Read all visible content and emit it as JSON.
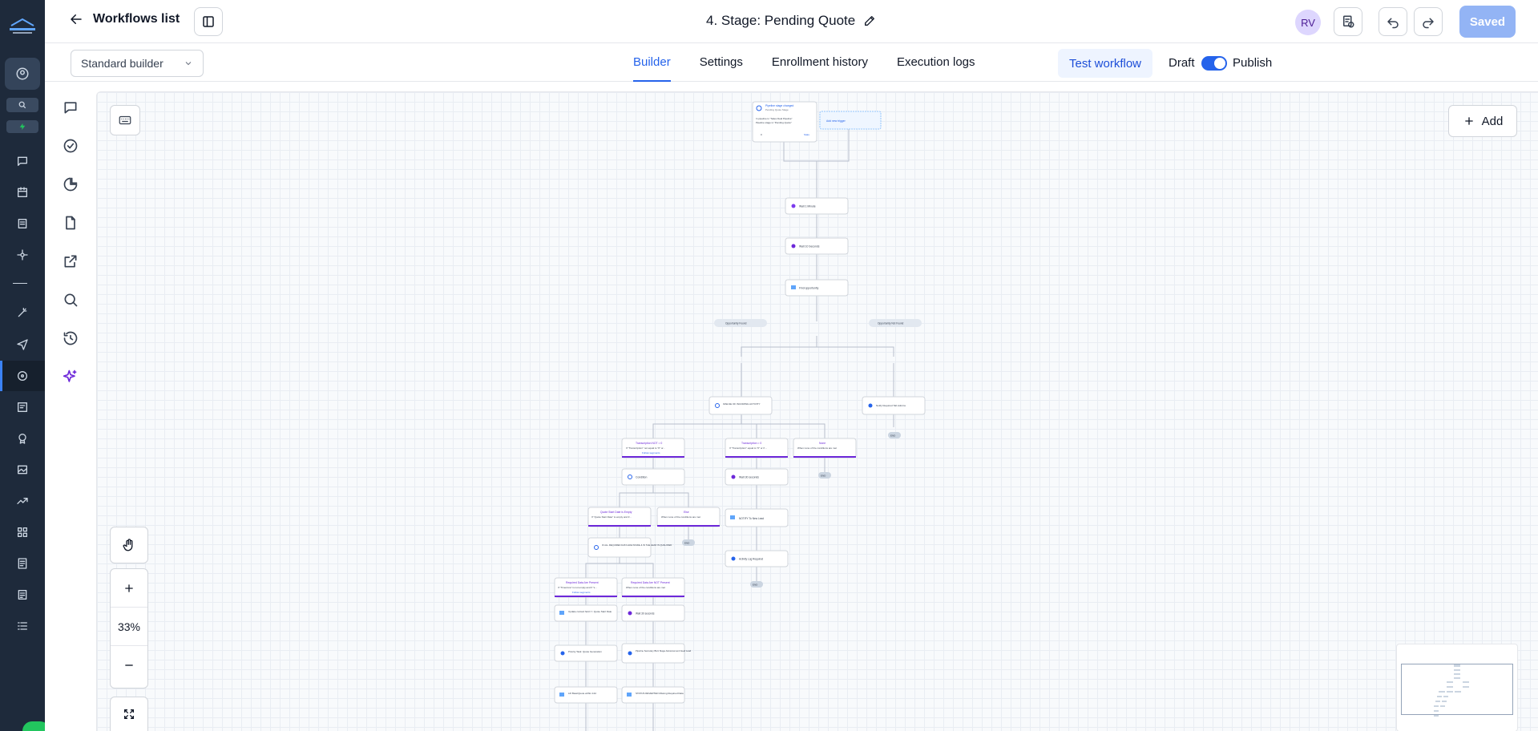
{
  "header": {
    "back_label": "Workflows list",
    "workflow_title": "4. Stage: Pending Quote",
    "avatar_initials": "RV",
    "saved_label": "Saved"
  },
  "subheader": {
    "builder_mode": "Standard builder",
    "tabs": [
      {
        "label": "Builder",
        "active": true
      },
      {
        "label": "Settings",
        "active": false
      },
      {
        "label": "Enrollment history",
        "active": false
      },
      {
        "label": "Execution logs",
        "active": false
      }
    ],
    "test_label": "Test workflow",
    "draft_label": "Draft",
    "publish_label": "Publish",
    "publish_on": true
  },
  "canvas": {
    "add_label": "Add",
    "zoom_level": "33%"
  },
  "colors": {
    "accent": "#2563eb",
    "rail": "#1e2a3b",
    "node_accent": "#6d28d9"
  },
  "flow": {
    "trigger": {
      "title": "Pipeline stage changed",
      "subtitle": "Pending Quote Stage",
      "line1": "In pipeline is \"Sales Deal Pipeline\"",
      "line2": "Pipeline stage is \"Pending Quote\"",
      "count": "0",
      "stats": "Stats"
    },
    "add_trigger": "Add new trigger",
    "steps": {
      "wait1": "Wait 1 Minute",
      "wait2": "Wait 10 Seconds",
      "find": "Find opportunity",
      "found": "Opportunity Found",
      "not_found": "Opportunity Not Found",
      "notify": "Notify Required Tab Admins",
      "end1": "END",
      "ifelse1": "IF/ELSE OF INCOMING ACTIVITY",
      "branch_a": "Transcription NOT = 0",
      "branch_a_desc": "If \"Transcription\" not equal to \"0\" or...",
      "branch_b": "Transcription = 0",
      "branch_b_desc": "If \"Transcription\" equal to \"0\" or if ...",
      "branch_c": "None",
      "branch_c_desc": "When none of the conditions are met",
      "follow": "Follow segments",
      "end2": "END",
      "condition": "Condition",
      "wait3": "Wait 30 seconds",
      "qsd_empty": "Quote Start Date is Empty",
      "qsd_empty_desc": "If \"Quote Start Date\" is empty and if...",
      "else": "Else",
      "else_desc": "When none of the conditions are met",
      "end3": "END",
      "notify_new": "NOTIFY To New Lead",
      "if_all": "IF ALL REQUIRED DATA ARE INSIDE & IN THE LEAD IS QUALIFIED",
      "activity": "Activity Log Required",
      "end4": "END",
      "req_present": "Required Data Are Present",
      "req_present_desc": "If \"Timezone\" is not empty and if \"s...",
      "req_not": "Required Data Are NOT Present",
      "req_not_desc": "When none of the conditions are met",
      "update": "Update contact field => Quote Start Date",
      "wait4": "Wait 30 seconds",
      "priority": "Priority Task: Quote Generation",
      "pipeline_sec": "Pipeline Secretary BH1 Stage Advancement Need Lead",
      "lift": "Lift BasicQuote within 14d",
      "status": "STATUS REVERTED Missing Required Data"
    }
  }
}
